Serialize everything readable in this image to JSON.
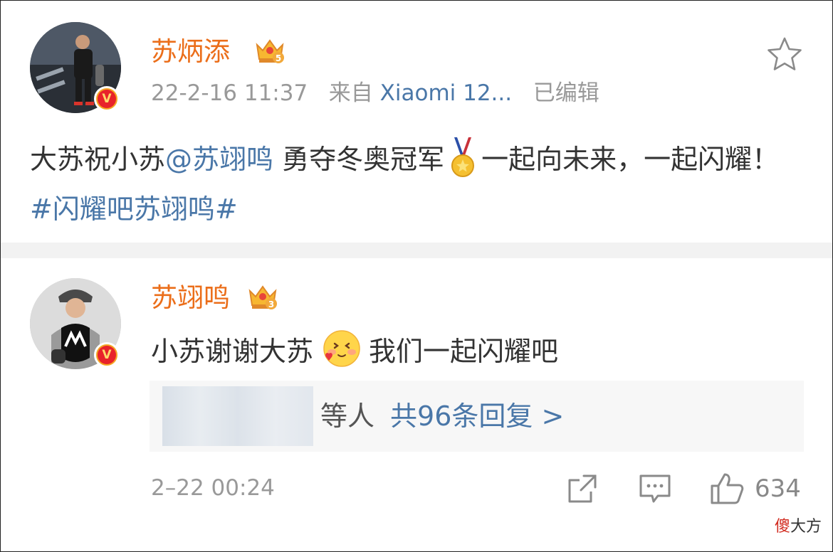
{
  "post": {
    "author": "苏炳添",
    "level_badge": "5",
    "timestamp": "22-2-16 11:37",
    "source_prefix": "来自",
    "source": "Xiaomi 12...",
    "edited": "已编辑",
    "content_prefix": "大苏祝小苏",
    "mention": "@苏翊鸣",
    "content_middle": " 勇夺冬奥冠军",
    "content_suffix": "一起向未来，一起闪耀！",
    "hashtag": "#闪耀吧苏翊鸣#"
  },
  "comment": {
    "author": "苏翊鸣",
    "level_badge": "3",
    "text_before": "小苏谢谢大苏",
    "text_after": "我们一起闪耀吧",
    "replies_suffix": "等人",
    "replies_link": "共96条回复 >",
    "timestamp": "2–22 00:24",
    "like_count": "634"
  },
  "watermark": {
    "red": "傻",
    "black": "大方"
  },
  "colors": {
    "name_orange": "#eb6e1a",
    "link_blue": "#4a77a8",
    "meta_gray": "#999999"
  },
  "icons": [
    "star-icon",
    "crown-icon",
    "verified-v-icon",
    "medal-icon",
    "blush-emoji-icon",
    "share-icon",
    "comment-icon",
    "like-icon"
  ]
}
